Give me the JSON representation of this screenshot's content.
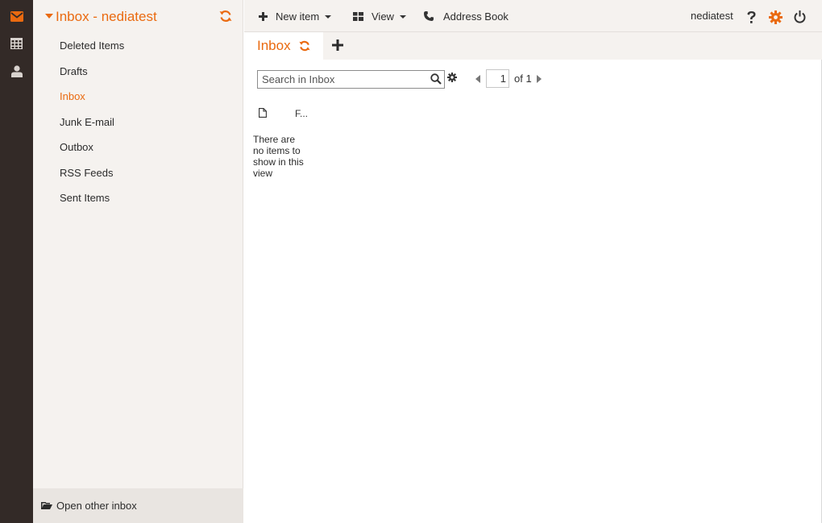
{
  "rail": {
    "items": [
      {
        "icon": "mail-icon",
        "active": true
      },
      {
        "icon": "calendar-icon",
        "active": false
      },
      {
        "icon": "contacts-icon",
        "active": false
      }
    ]
  },
  "folders": {
    "title": "Inbox - nediatest",
    "items": [
      {
        "label": "Deleted Items",
        "active": false
      },
      {
        "label": "Drafts",
        "active": false
      },
      {
        "label": "Inbox",
        "active": true
      },
      {
        "label": "Junk E-mail",
        "active": false
      },
      {
        "label": "Outbox",
        "active": false
      },
      {
        "label": "RSS Feeds",
        "active": false
      },
      {
        "label": "Sent Items",
        "active": false
      }
    ],
    "open_other_label": "Open other inbox"
  },
  "toolbar": {
    "new_item_label": "New item",
    "view_label": "View",
    "address_book_label": "Address Book",
    "username": "nediatest"
  },
  "tabs": {
    "active_label": "Inbox"
  },
  "search": {
    "placeholder": "Search in Inbox"
  },
  "pagination": {
    "current_page": "1",
    "of_label": "of 1"
  },
  "list": {
    "from_header": "F...",
    "empty_message": "There are no items to show in this view"
  },
  "colors": {
    "accent": "#ea6a10",
    "rail_bg": "#332a27",
    "pane_bg": "#f5f2ef"
  }
}
